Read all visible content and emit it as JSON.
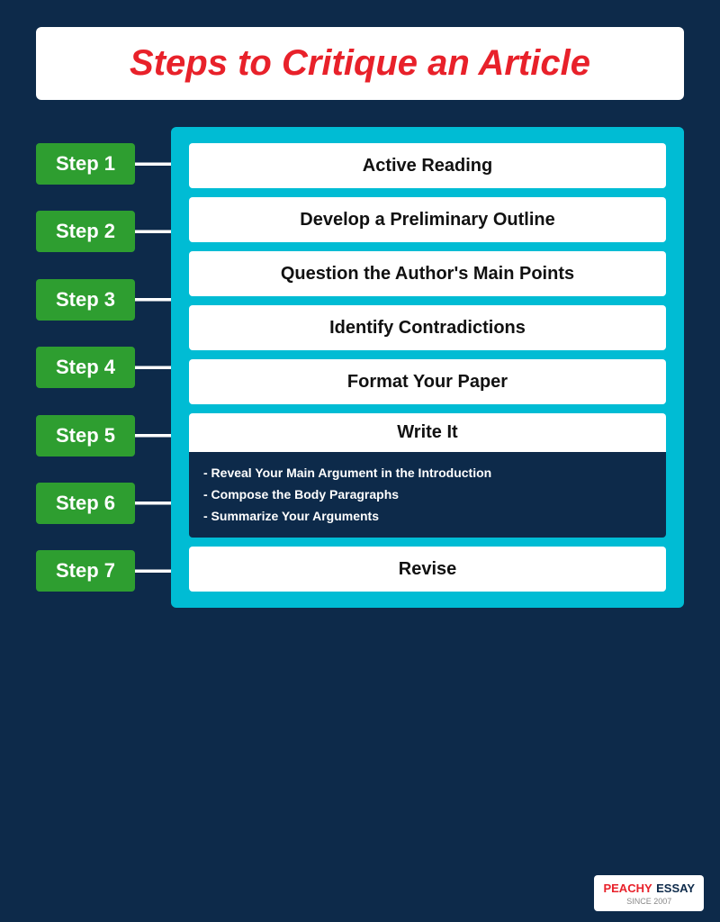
{
  "title": "Steps to Critique an Article",
  "steps": [
    {
      "label": "Step 1"
    },
    {
      "label": "Step 2"
    },
    {
      "label": "Step 3"
    },
    {
      "label": "Step 4"
    },
    {
      "label": "Step 5"
    },
    {
      "label": "Step 6"
    },
    {
      "label": "Step 7"
    }
  ],
  "content": [
    {
      "id": "step1",
      "text": "Active Reading"
    },
    {
      "id": "step2",
      "text": "Develop a Preliminary Outline"
    },
    {
      "id": "step3",
      "text": "Question the Author's Main Points"
    },
    {
      "id": "step4",
      "text": "Identify Contradictions"
    },
    {
      "id": "step5",
      "text": "Format Your Paper"
    },
    {
      "id": "step6_title",
      "text": "Write It"
    },
    {
      "id": "step6_sub1",
      "text": "- Reveal Your Main Argument in the Introduction"
    },
    {
      "id": "step6_sub2",
      "text": "- Compose the Body Paragraphs"
    },
    {
      "id": "step6_sub3",
      "text": "- Summarize Your Arguments"
    },
    {
      "id": "step7",
      "text": "Revise"
    }
  ],
  "logo": {
    "peachy": "PEACHY",
    "essay": "ESSAY",
    "since": "SINCE 2007"
  }
}
